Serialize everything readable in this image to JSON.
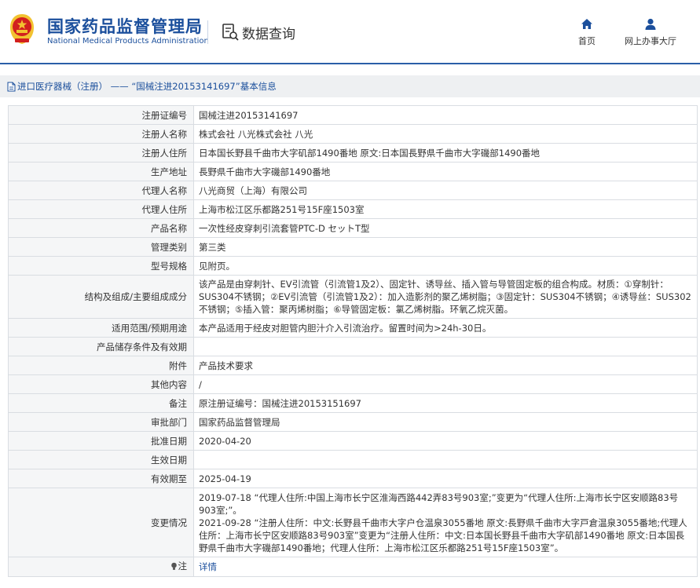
{
  "header": {
    "org_name_cn": "国家药品监督管理局",
    "org_name_en": "National Medical Products Administration",
    "query_title": "数据查询",
    "nav": [
      {
        "label": "首页",
        "icon": "home-icon"
      },
      {
        "label": "网上办事大厅",
        "icon": "user-icon"
      }
    ]
  },
  "colors": {
    "brand": "#1b4f9c",
    "emblem_red": "#d21f1f",
    "emblem_gold": "#f2c230"
  },
  "breadcrumb": {
    "icon": "document-icon",
    "category": "进口医疗器械（注册）",
    "separator": " —— ",
    "title": "“国械注进20153141697”基本信息"
  },
  "record": {
    "rows": [
      {
        "label": "注册证编号",
        "value": "国械注进20153141697"
      },
      {
        "label": "注册人名称",
        "value": "株式会社 八光株式会社 八光"
      },
      {
        "label": "注册人住所",
        "value": "日本国长野县千曲市大字矶部1490番地 原文:日本国長野県千曲市大字磯部1490番地"
      },
      {
        "label": "生产地址",
        "value": "長野県千曲市大字磯部1490番地"
      },
      {
        "label": "代理人名称",
        "value": "八光商贸（上海）有限公司"
      },
      {
        "label": "代理人住所",
        "value": "上海市松江区乐都路251号15F座1503室"
      },
      {
        "label": "产品名称",
        "value": "一次性经皮穿刺引流套管PTC-D セットT型"
      },
      {
        "label": "管理类别",
        "value": "第三类"
      },
      {
        "label": "型号规格",
        "value": "见附页。"
      },
      {
        "label": "结构及组成/主要组成成分",
        "value": "该产品是由穿刺针、EV引流管（引流管1及2）、固定针、诱导丝、插入管与导管固定板的组合构成。材质：①穿制针：SUS304不锈钢；②EV引流管（引流管1及2）：加入造影剂的聚乙烯树脂；③固定针：SUS304不锈钢；④诱导丝：SUS302不锈钢；⑤插入管：聚丙烯树脂；⑥导管固定板：氯乙烯树脂。环氧乙烷灭菌。"
      },
      {
        "label": "适用范围/预期用途",
        "value": "本产品适用于经皮对胆管内胆汁介入引流治疗。留置时间为>24h-30日。"
      },
      {
        "label": "产品储存条件及有效期",
        "value": ""
      },
      {
        "label": "附件",
        "value": "产品技术要求"
      },
      {
        "label": "其他内容",
        "value": "/"
      },
      {
        "label": "备注",
        "value": "原注册证编号：国械注进20153151697"
      },
      {
        "label": "审批部门",
        "value": "国家药品监督管理局"
      },
      {
        "label": "批准日期",
        "value": "2020-04-20"
      },
      {
        "label": "生效日期",
        "value": ""
      },
      {
        "label": "有效期至",
        "value": "2025-04-19"
      }
    ],
    "changes": {
      "label": "变更情况",
      "entries": [
        "2019-07-18 “代理人住所:中国上海市长宁区淮海西路442弄83号903室;”变更为“代理人住所:上海市长宁区安顺路83号903室;”。",
        "2021-09-28 “注册人住所：中文:长野县千曲市大字户仓温泉3055番地 原文:長野県千曲市大字戸倉温泉3055番地;代理人住所：上海市长宁区安顺路83号903室”变更为“注册人住所：中文:日本国长野县千曲市大字矶部1490番地 原文:日本国長野県千曲市大字磯部1490番地；代理人住所：上海市松江区乐都路251号15F座1503室”。"
      ]
    },
    "note": {
      "label": "注",
      "icon": "lightbulb-icon",
      "link": "详情"
    }
  }
}
